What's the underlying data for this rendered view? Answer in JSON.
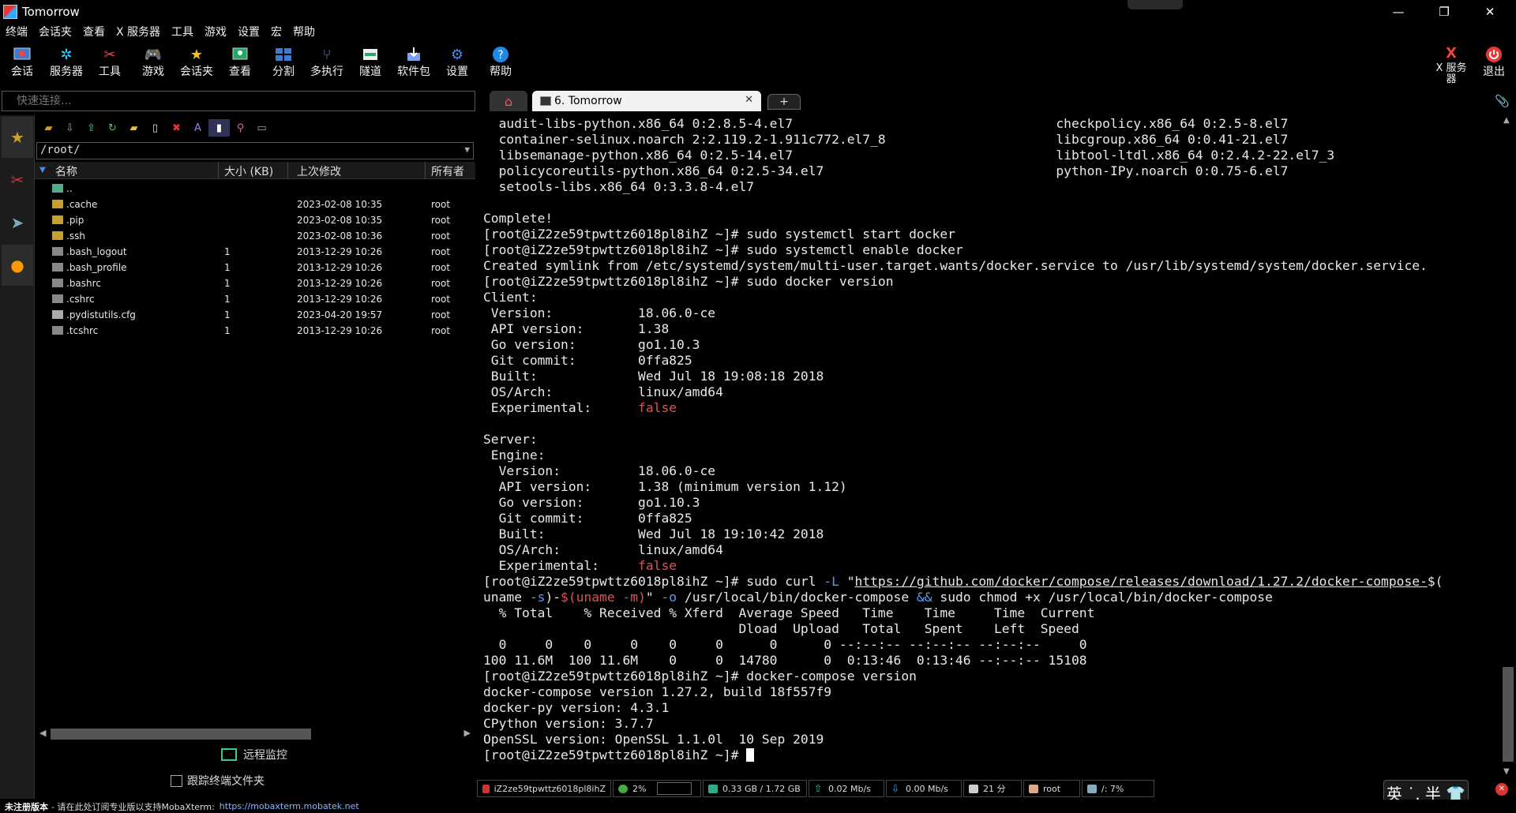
{
  "window": {
    "title": "Tomorrow",
    "controls": [
      "—",
      "❐",
      "✕"
    ]
  },
  "menu": [
    "终端",
    "会话夹",
    "查看",
    "X 服务器",
    "工具",
    "游戏",
    "设置",
    "宏",
    "帮助"
  ],
  "toolbar": [
    {
      "label": "会话",
      "icon": "session-icon"
    },
    {
      "label": "服务器",
      "icon": "servers-icon"
    },
    {
      "label": "工具",
      "icon": "tools-icon"
    },
    {
      "label": "游戏",
      "icon": "games-icon"
    },
    {
      "label": "会话夹",
      "icon": "star-icon"
    },
    {
      "label": "查看",
      "icon": "view-icon"
    },
    {
      "label": "分割",
      "icon": "split-icon"
    },
    {
      "label": "多执行",
      "icon": "multiexec-icon"
    },
    {
      "label": "隧道",
      "icon": "tunnel-icon"
    },
    {
      "label": "软件包",
      "icon": "packages-icon"
    },
    {
      "label": "设置",
      "icon": "settings-icon"
    },
    {
      "label": "帮助",
      "icon": "help-icon"
    }
  ],
  "toolbar_right": {
    "xserver_label": "X 服务\n器",
    "exit_label": "退出"
  },
  "quick_connect": {
    "placeholder": "快速连接..."
  },
  "file_panel": {
    "path": "/root/",
    "columns": {
      "name": "名称",
      "size": "大小 (KB)",
      "modified": "上次修改",
      "owner": "所有者"
    },
    "rows": [
      {
        "name": "..",
        "size": "",
        "date": "",
        "owner": "",
        "type": "up"
      },
      {
        "name": ".cache",
        "size": "",
        "date": "2023-02-08 10:35",
        "owner": "root",
        "type": "folder"
      },
      {
        "name": ".pip",
        "size": "",
        "date": "2023-02-08 10:35",
        "owner": "root",
        "type": "folder"
      },
      {
        "name": ".ssh",
        "size": "",
        "date": "2023-02-08 10:36",
        "owner": "root",
        "type": "folder"
      },
      {
        "name": ".bash_logout",
        "size": "1",
        "date": "2013-12-29 10:26",
        "owner": "root",
        "type": "file"
      },
      {
        "name": ".bash_profile",
        "size": "1",
        "date": "2013-12-29 10:26",
        "owner": "root",
        "type": "file"
      },
      {
        "name": ".bashrc",
        "size": "1",
        "date": "2013-12-29 10:26",
        "owner": "root",
        "type": "file"
      },
      {
        "name": ".cshrc",
        "size": "1",
        "date": "2013-12-29 10:26",
        "owner": "root",
        "type": "file"
      },
      {
        "name": ".pydistutils.cfg",
        "size": "1",
        "date": "2023-04-20 19:57",
        "owner": "root",
        "type": "file"
      },
      {
        "name": ".tcshrc",
        "size": "1",
        "date": "2013-12-29 10:26",
        "owner": "root",
        "type": "file"
      }
    ],
    "remote_monitor": "远程监控",
    "follow_terminal_folder": "跟踪终端文件夹"
  },
  "tabs": {
    "session_tab": "6. Tomorrow",
    "new_tab": "+"
  },
  "terminal": {
    "lines": [
      [
        {
          "t": "  audit-libs-python.x86_64 0:2.8.5-4.el7                                  checkpolicy.x86_64 0:2.5-8.el7"
        }
      ],
      [
        {
          "t": "  container-selinux.noarch 2:2.119.2-1.911c772.el7_8                      libcgroup.x86_64 0:0.41-21.el7"
        }
      ],
      [
        {
          "t": "  libsemanage-python.x86_64 0:2.5-14.el7                                  libtool-ltdl.x86_64 0:2.4.2-22.el7_3"
        }
      ],
      [
        {
          "t": "  policycoreutils-python.x86_64 0:2.5-34.el7                              python-IPy.noarch 0:0.75-6.el7"
        }
      ],
      [
        {
          "t": "  setools-libs.x86_64 0:3.3.8-4.el7"
        }
      ],
      [
        {
          "t": ""
        }
      ],
      [
        {
          "t": "Complete!"
        }
      ],
      [
        {
          "t": "[root@iZ2ze59tpwttz6018pl8ihZ ~]# sudo systemctl start docker"
        }
      ],
      [
        {
          "t": "[root@iZ2ze59tpwttz6018pl8ihZ ~]# sudo systemctl enable docker"
        }
      ],
      [
        {
          "t": "Created symlink from /etc/systemd/system/multi-user.target.wants/docker.service to /usr/lib/systemd/system/docker.service."
        }
      ],
      [
        {
          "t": "[root@iZ2ze59tpwttz6018pl8ihZ ~]# sudo docker version"
        }
      ],
      [
        {
          "t": "Client:"
        }
      ],
      [
        {
          "t": " Version:           18.06.0-ce"
        }
      ],
      [
        {
          "t": " API version:       1.38"
        }
      ],
      [
        {
          "t": " Go version:        go1.10.3"
        }
      ],
      [
        {
          "t": " Git commit:        0ffa825"
        }
      ],
      [
        {
          "t": " Built:             Wed Jul 18 19:08:18 2018"
        }
      ],
      [
        {
          "t": " OS/Arch:           linux/amd64"
        }
      ],
      [
        {
          "t": " Experimental:      "
        },
        {
          "t": "false",
          "c": "red"
        }
      ],
      [
        {
          "t": ""
        }
      ],
      [
        {
          "t": "Server:"
        }
      ],
      [
        {
          "t": " Engine:"
        }
      ],
      [
        {
          "t": "  Version:          18.06.0-ce"
        }
      ],
      [
        {
          "t": "  API version:      1.38 (minimum version 1.12)"
        }
      ],
      [
        {
          "t": "  Go version:       go1.10.3"
        }
      ],
      [
        {
          "t": "  Git commit:       0ffa825"
        }
      ],
      [
        {
          "t": "  Built:            Wed Jul 18 19:10:42 2018"
        }
      ],
      [
        {
          "t": "  OS/Arch:          linux/amd64"
        }
      ],
      [
        {
          "t": "  Experimental:     "
        },
        {
          "t": "false",
          "c": "red"
        }
      ],
      [
        {
          "t": "[root@iZ2ze59tpwttz6018pl8ihZ ~]# sudo curl "
        },
        {
          "t": "-L",
          "c": "blue"
        },
        {
          "t": " \""
        },
        {
          "t": "https://github.com/docker/compose/releases/download/1.27.2/docker-compose-",
          "c": "url"
        },
        {
          "t": "$("
        }
      ],
      [
        {
          "t": "uname "
        },
        {
          "t": "-s",
          "c": "blue"
        },
        {
          "t": ")-"
        },
        {
          "t": "$(uname -m)",
          "c": "red"
        },
        {
          "t": "\" "
        },
        {
          "t": "-o",
          "c": "blue"
        },
        {
          "t": " /usr/local/bin/docker-compose"
        }
      ],
      [
        {
          "t": "  % Total    % Received % Xferd  Average Speed   Time    Time     Time  Current"
        }
      ],
      [
        {
          "t": "                                 Dload  Upload   Total   Spent    Left  Speed"
        }
      ],
      [
        {
          "t": "  0     0    0     0    0     0      0      0 --:--:-- --:--:-- --:--:--     0"
        }
      ],
      [
        {
          "t": "100 11.6M  100 11.6M    0     0  14780      0  0:13:46  0:13:46 --:--:-- 15108"
        }
      ],
      [
        {
          "t": "[root@iZ2ze59tpwttz6018pl8ihZ ~]# docker-compose version"
        }
      ],
      [
        {
          "t": "docker-compose version 1.27.2, build 18f557f9"
        }
      ],
      [
        {
          "t": "docker-py version: 4.3.1"
        }
      ],
      [
        {
          "t": "CPython version: 3.7.7"
        }
      ],
      [
        {
          "t": "OpenSSL version: OpenSSL 1.1.0l  10 Sep 2019"
        }
      ],
      [
        {
          "t": "[root@iZ2ze59tpwttz6018pl8ihZ ~]# "
        },
        {
          "t": "",
          "c": "cursor"
        }
      ]
    ],
    "and_sign": "&&",
    "and_line_index": 30
  },
  "status": {
    "host": "iZ2ze59tpwttz6018pl8ihZ",
    "cpu": "2%",
    "memory": "0.33 GB / 1.72 GB",
    "upload": "0.02 Mb/s",
    "download": "0.00 Mb/s",
    "uptime": "21 分",
    "user": "root",
    "disk": "/: 7%"
  },
  "ime": "英 ˙, 半 👕",
  "bottom": {
    "unregistered": "未注册版本",
    "message": " - 请在此处订阅专业版以支持MobaXterm:",
    "link": "https://mobaxterm.mobatek.net"
  },
  "colors": {
    "accent_red": "#e05050",
    "accent_blue": "#5599ff",
    "link": "#8ab4ff"
  }
}
